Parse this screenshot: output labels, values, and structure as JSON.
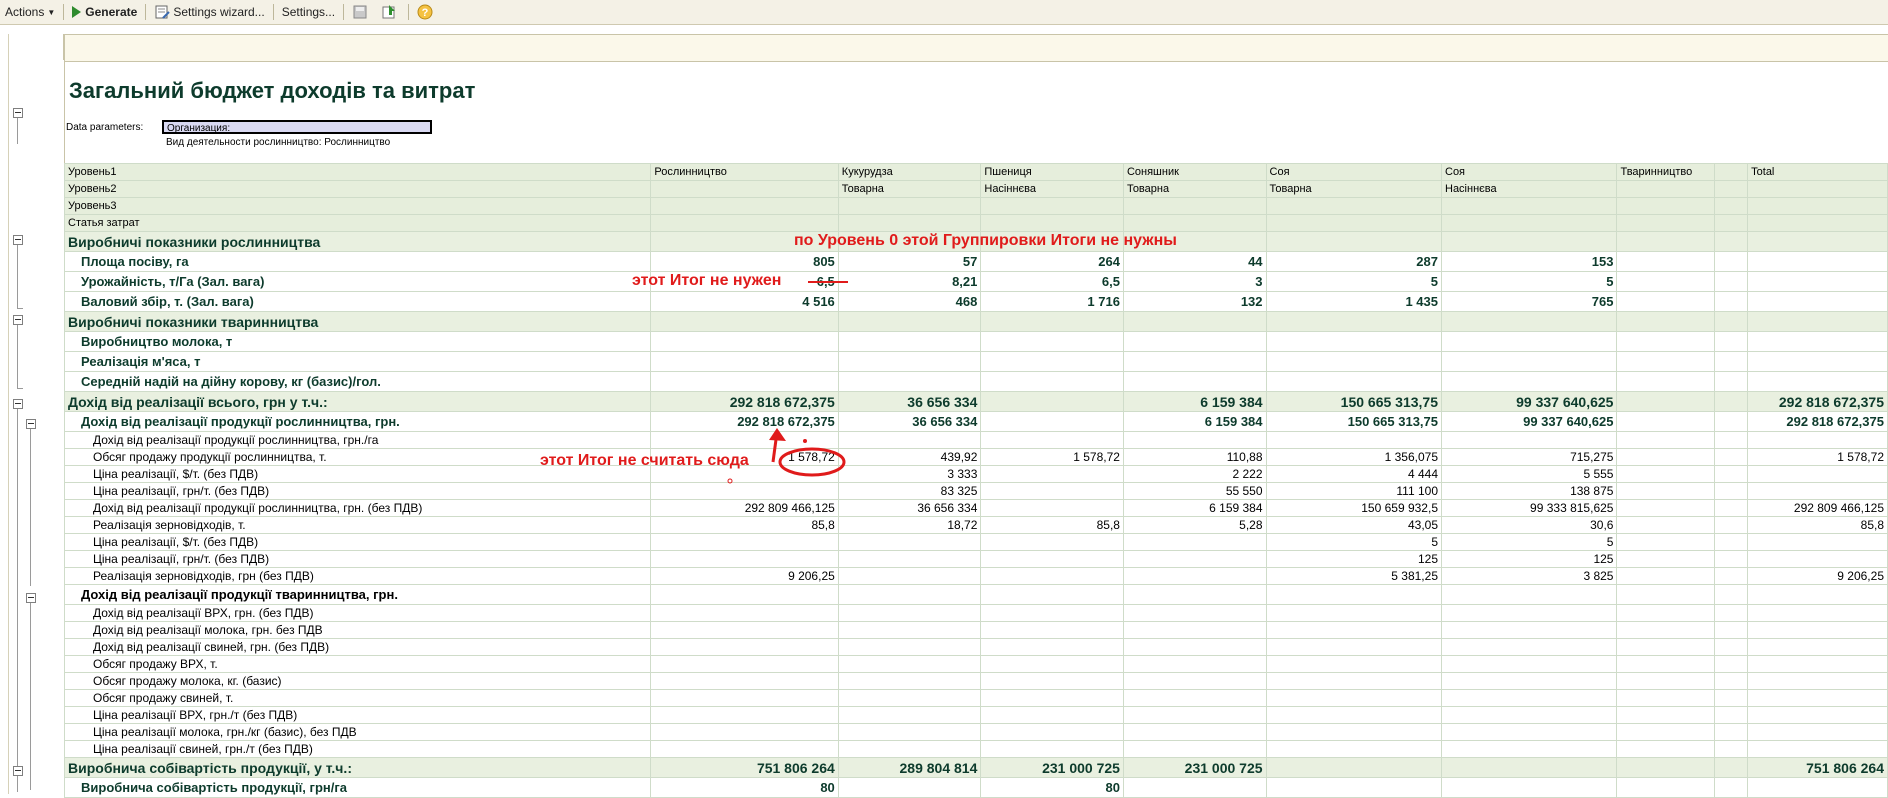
{
  "toolbar": {
    "actions_label": "Actions",
    "generate_label": "Generate",
    "settings_wizard_label": "Settings wizard...",
    "settings_label": "Settings..."
  },
  "report": {
    "title": "Загальний бюджет доходів та витрат",
    "data_parameters_label": "Data parameters:",
    "organization_filter": "Организация:",
    "activity_filter": "Вид деятельности рослинництво: Рослинництво"
  },
  "header_rows": [
    [
      "Уровень1",
      "Рослинництво",
      "Кукурудза",
      "Пшениця",
      "Соняшник",
      "Соя",
      "Соя",
      "Тваринництво",
      "",
      "Total"
    ],
    [
      "Уровень2",
      "",
      "Товарна",
      "Насіннєва",
      "Товарна",
      "Товарна",
      "Насіннєва",
      "",
      "",
      ""
    ],
    [
      "Уровень3",
      "",
      "",
      "",
      "",
      "",
      "",
      "",
      "",
      ""
    ],
    [
      "Статья затрат",
      "",
      "",
      "",
      "",
      "",
      "",
      "",
      "",
      ""
    ]
  ],
  "rows": [
    {
      "s": "g0",
      "i": 0,
      "c": [
        "Виробничі показники рослинництва",
        "",
        "",
        "",
        "",
        "",
        "",
        "",
        "",
        ""
      ]
    },
    {
      "s": "g1",
      "i": 1,
      "c": [
        "Площа посіву, га",
        "805",
        "57",
        "264",
        "44",
        "287",
        "153",
        "",
        "",
        ""
      ]
    },
    {
      "s": "g1",
      "i": 1,
      "c": [
        "Урожайність, т/Га (Зал. вага)",
        "6,5",
        "8,21",
        "6,5",
        "3",
        "5",
        "5",
        "",
        "",
        ""
      ]
    },
    {
      "s": "g1",
      "i": 1,
      "c": [
        "Валовий збір, т. (Зал. вага)",
        "4 516",
        "468",
        "1 716",
        "132",
        "1 435",
        "765",
        "",
        "",
        ""
      ]
    },
    {
      "s": "g0",
      "i": 0,
      "c": [
        "Виробничі показники тваринництва",
        "",
        "",
        "",
        "",
        "",
        "",
        "",
        "",
        ""
      ]
    },
    {
      "s": "g1",
      "i": 1,
      "c": [
        "Виробництво молока, т",
        "",
        "",
        "",
        "",
        "",
        "",
        "",
        "",
        ""
      ]
    },
    {
      "s": "g1",
      "i": 1,
      "c": [
        "Реалізація м'яса, т",
        "",
        "",
        "",
        "",
        "",
        "",
        "",
        "",
        ""
      ]
    },
    {
      "s": "g1",
      "i": 1,
      "c": [
        "Середній надій на дійну корову, кг (базис)/гол.",
        "",
        "",
        "",
        "",
        "",
        "",
        "",
        "",
        ""
      ]
    },
    {
      "s": "g0",
      "i": 0,
      "c": [
        "Дохід від реалізації всього, грн у т.ч.:",
        "292 818 672,375",
        "36 656 334",
        "",
        "6 159 384",
        "150 665 313,75",
        "99 337 640,625",
        "",
        "",
        "292 818 672,375"
      ]
    },
    {
      "s": "g1",
      "i": 1,
      "c": [
        "Дохід від реалізації продукції рослинництва, грн.",
        "292 818 672,375",
        "36 656 334",
        "",
        "6 159 384",
        "150 665 313,75",
        "99 337 640,625",
        "",
        "",
        "292 818 672,375"
      ]
    },
    {
      "s": "g2",
      "i": 2,
      "c": [
        "Дохід від реалізації продукції рослинництва, грн./га",
        "",
        "",
        "",
        "",
        "",
        "",
        "",
        "",
        ""
      ]
    },
    {
      "s": "g2",
      "i": 2,
      "c": [
        "Обсяг продажу продукції рослинництва, т.",
        "1 578,72",
        "439,92",
        "1 578,72",
        "110,88",
        "1 356,075",
        "715,275",
        "",
        "",
        "1 578,72"
      ]
    },
    {
      "s": "g2",
      "i": 2,
      "c": [
        "Ціна реалізації, $/т. (без ПДВ)",
        "",
        "3 333",
        "",
        "2 222",
        "4 444",
        "5 555",
        "",
        "",
        ""
      ]
    },
    {
      "s": "g2",
      "i": 2,
      "c": [
        "Ціна реалізації, грн/т. (без ПДВ)",
        "",
        "83 325",
        "",
        "55 550",
        "111 100",
        "138 875",
        "",
        "",
        ""
      ]
    },
    {
      "s": "g2",
      "i": 2,
      "c": [
        "Дохід від реалізації продукції рослинництва, грн. (без ПДВ)",
        "292 809 466,125",
        "36 656 334",
        "",
        "6 159 384",
        "150 659 932,5",
        "99 333 815,625",
        "",
        "",
        "292 809 466,125"
      ]
    },
    {
      "s": "g2",
      "i": 2,
      "c": [
        "Реалізація зерновідходів, т.",
        "85,8",
        "18,72",
        "85,8",
        "5,28",
        "43,05",
        "30,6",
        "",
        "",
        "85,8"
      ]
    },
    {
      "s": "g2",
      "i": 2,
      "c": [
        "Ціна реалізації, $/т. (без ПДВ)",
        "",
        "",
        "",
        "",
        "5",
        "5",
        "",
        "",
        ""
      ]
    },
    {
      "s": "g2",
      "i": 2,
      "c": [
        "Ціна реалізації, грн/т. (без ПДВ)",
        "",
        "",
        "",
        "",
        "125",
        "125",
        "",
        "",
        ""
      ]
    },
    {
      "s": "g2",
      "i": 2,
      "c": [
        "Реалізація зерновідходів, грн (без ПДВ)",
        "9 206,25",
        "",
        "",
        "",
        "5 381,25",
        "3 825",
        "",
        "",
        "9 206,25"
      ]
    },
    {
      "s": "g1b",
      "i": 1,
      "c": [
        "Дохід від реалізації продукції тваринництва, грн.",
        "",
        "",
        "",
        "",
        "",
        "",
        "",
        "",
        ""
      ]
    },
    {
      "s": "g2",
      "i": 2,
      "c": [
        "Дохід від реалізації ВРХ, грн. (без ПДВ)",
        "",
        "",
        "",
        "",
        "",
        "",
        "",
        "",
        ""
      ]
    },
    {
      "s": "g2",
      "i": 2,
      "c": [
        "Дохід від реалізації молока, грн. без ПДВ",
        "",
        "",
        "",
        "",
        "",
        "",
        "",
        "",
        ""
      ]
    },
    {
      "s": "g2",
      "i": 2,
      "c": [
        "Дохід від реалізації свиней, грн. (без ПДВ)",
        "",
        "",
        "",
        "",
        "",
        "",
        "",
        "",
        ""
      ]
    },
    {
      "s": "g2",
      "i": 2,
      "c": [
        "Обсяг продажу ВРХ, т.",
        "",
        "",
        "",
        "",
        "",
        "",
        "",
        "",
        ""
      ]
    },
    {
      "s": "g2",
      "i": 2,
      "c": [
        "Обсяг продажу молока, кг. (базис)",
        "",
        "",
        "",
        "",
        "",
        "",
        "",
        "",
        ""
      ]
    },
    {
      "s": "g2",
      "i": 2,
      "c": [
        "Обсяг продажу свиней, т.",
        "",
        "",
        "",
        "",
        "",
        "",
        "",
        "",
        ""
      ]
    },
    {
      "s": "g2",
      "i": 2,
      "c": [
        "Ціна реалізації ВРХ, грн./т (без ПДВ)",
        "",
        "",
        "",
        "",
        "",
        "",
        "",
        "",
        ""
      ]
    },
    {
      "s": "g2",
      "i": 2,
      "c": [
        "Ціна реалізації молока, грн./кг (базис), без ПДВ",
        "",
        "",
        "",
        "",
        "",
        "",
        "",
        "",
        ""
      ]
    },
    {
      "s": "g2",
      "i": 2,
      "c": [
        "Ціна реалізації свиней, грн./т (без ПДВ)",
        "",
        "",
        "",
        "",
        "",
        "",
        "",
        "",
        ""
      ]
    },
    {
      "s": "g0",
      "i": 0,
      "c": [
        "Виробнича собівартість продукції, у т.ч.:",
        "751 806 264",
        "289 804 814",
        "231 000 725",
        "231 000 725",
        "",
        "",
        "",
        "",
        "751 806 264"
      ]
    },
    {
      "s": "g1",
      "i": 1,
      "c": [
        "Виробнича собівартість продукції, грн/га",
        "80",
        "",
        "80",
        "",
        "",
        "",
        "",
        "",
        ""
      ]
    }
  ],
  "annotations": {
    "no_totals_level0": "по Уровень 0 этой Группировки Итоги не нужны",
    "total_not_needed": "этот Итог не нужен",
    "total_do_not_count": "этот Итог не считать сюда"
  },
  "colors": {
    "annotation": "#e01b1b",
    "header_bg": "#e6eedc",
    "title": "#0d3b2c"
  }
}
